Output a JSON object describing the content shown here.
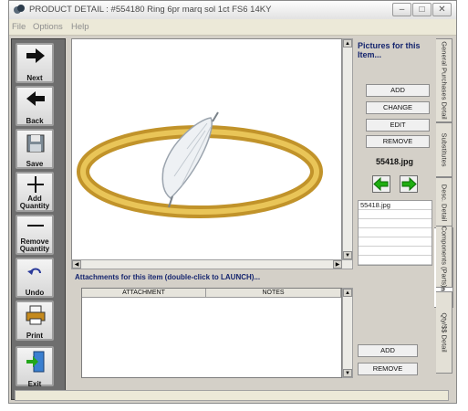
{
  "window": {
    "title": "PRODUCT DETAIL : #554180 Ring 6pr marq sol 1ct  FS6 14KY",
    "controls": [
      "minimize",
      "maximize",
      "close"
    ]
  },
  "menu": {
    "items": [
      "File",
      "Options",
      "Help"
    ]
  },
  "toolbar": {
    "buttons": [
      {
        "label": "Next",
        "icon": "right-arrow-icon"
      },
      {
        "label": "Back",
        "icon": "left-arrow-icon"
      },
      {
        "label": "Save",
        "icon": "floppy-disk-icon"
      },
      {
        "label": "Add Quantity",
        "icon": "plus-icon"
      },
      {
        "label": "Remove Quantity",
        "icon": "minus-icon"
      },
      {
        "label": "Undo",
        "icon": "undo-icon"
      },
      {
        "label": "Print",
        "icon": "printer-icon"
      },
      {
        "label": "Exit",
        "icon": "exit-door-icon"
      }
    ]
  },
  "pictures": {
    "title": "Pictures for this Item...",
    "buttons": {
      "add": "ADD",
      "change": "CHANGE",
      "edit": "EDIT",
      "remove": "REMOVE"
    },
    "current_file": "55418.jpg",
    "files": [
      "55418.jpg"
    ]
  },
  "tabs": [
    "General Purchases Detail",
    "Substitutes",
    "Desc. Detail",
    "Pic. / Attachments",
    "Components (Parts)",
    "Qty/$$ Detail"
  ],
  "active_tab": "Pic. / Attachments",
  "attachments": {
    "label": "Attachments for this item (double-click to LAUNCH)...",
    "columns": [
      "ATTACHMENT",
      "NOTES"
    ],
    "rows": [],
    "buttons": {
      "add": "ADD",
      "remove": "REMOVE"
    }
  },
  "colors": {
    "accent_text": "#15256e",
    "arrow_green": "#1fae12",
    "ring_gold": "#d4a52a"
  }
}
